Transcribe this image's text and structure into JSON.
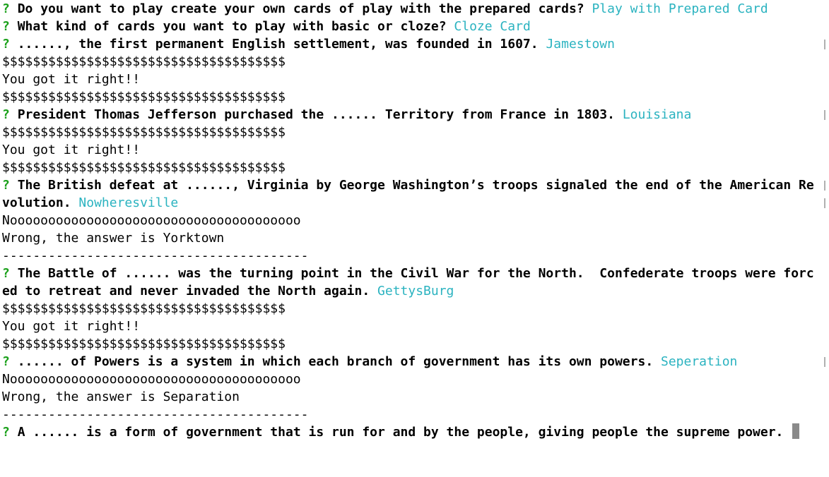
{
  "lines": [
    {
      "prompt": "?",
      "question": "Do you want to play create your own cards of play with the prepared cards?",
      "answer": "Play with Prepared Card"
    },
    {
      "prompt": "?",
      "question": "What kind of cards you want to play with basic or cloze?",
      "answer": "Cloze Card"
    },
    {
      "prompt": "?",
      "question": "......, the first permanent English settlement, was founded in 1607.",
      "answer": "Jamestown"
    },
    {
      "text": "$$$$$$$$$$$$$$$$$$$$$$$$$$$$$$$$$$$$$"
    },
    {
      "text": "You got it right!!"
    },
    {
      "text": "$$$$$$$$$$$$$$$$$$$$$$$$$$$$$$$$$$$$$"
    },
    {
      "prompt": "?",
      "question": "President Thomas Jefferson purchased the ...... Territory from France in 1803.",
      "answer": "Louisiana"
    },
    {
      "text": "$$$$$$$$$$$$$$$$$$$$$$$$$$$$$$$$$$$$$"
    },
    {
      "text": "You got it right!!"
    },
    {
      "text": "$$$$$$$$$$$$$$$$$$$$$$$$$$$$$$$$$$$$$"
    },
    {
      "prompt": "?",
      "question": "The British defeat at ......, Virginia by George Washington’s troops signaled the end of the American Re"
    },
    {
      "question": "volution.",
      "answer": "Nowheresville"
    },
    {
      "text": "Noooooooooooooooooooooooooooooooooooooo"
    },
    {
      "text": "Wrong, the answer is Yorktown"
    },
    {
      "text": "----------------------------------------"
    },
    {
      "prompt": "?",
      "question": "The Battle of ...... was the turning point in the Civil War for the North.  Confederate troops were forc"
    },
    {
      "question": "ed to retreat and never invaded the North again.",
      "answer": "GettysBurg"
    },
    {
      "text": "$$$$$$$$$$$$$$$$$$$$$$$$$$$$$$$$$$$$$"
    },
    {
      "text": "You got it right!!"
    },
    {
      "text": "$$$$$$$$$$$$$$$$$$$$$$$$$$$$$$$$$$$$$"
    },
    {
      "prompt": "?",
      "question": "...... of Powers is a system in which each branch of government has its own powers.",
      "answer": "Seperation"
    },
    {
      "text": "Noooooooooooooooooooooooooooooooooooooo"
    },
    {
      "text": "Wrong, the answer is Separation"
    },
    {
      "text": "----------------------------------------"
    },
    {
      "prompt": "?",
      "question": "A ...... is a form of government that is run for and by the people, giving people the supreme power.",
      "cursor": true
    }
  ],
  "colors": {
    "prompt": "#1aa01a",
    "answer": "#2bb3c0",
    "text": "#000000",
    "cursor": "#8a8a8a",
    "background": "#ffffff"
  }
}
